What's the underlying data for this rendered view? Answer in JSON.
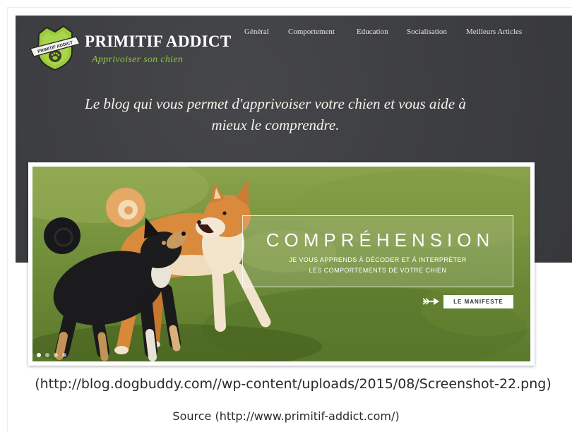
{
  "site": {
    "logo_ribbon": "PRIMITIF ADDICT",
    "title": "PRIMITIF ADDICT",
    "subtitle": "Apprivoiser son chien"
  },
  "nav": [
    {
      "label": "Général"
    },
    {
      "label": "Comportement"
    },
    {
      "label": "Education"
    },
    {
      "label": "Socialisation"
    },
    {
      "label": "Meilleurs Articles"
    }
  ],
  "tagline": {
    "line1": "Le blog qui vous permet d'apprivoiser votre chien et vous aide à",
    "line2": "mieux le comprendre."
  },
  "banner": {
    "heading": "COMPRÉHENSION",
    "line1": "JE VOUS APPRENDS À DÉCODER ET À INTERPRÉTER",
    "line2": "LES COMPORTEMENTS DE VOTRE CHIEN",
    "cta_label": "LE MANIFESTE",
    "slider": {
      "slide_count": 4,
      "active_index": 0
    }
  },
  "caption": {
    "image_url_text": "(http://blog.dogbuddy.com//wp-content/uploads/2015/08/Screenshot-22.png)",
    "source_text": "Source (http://www.primitif-addict.com/)"
  },
  "colors": {
    "header_bg": "#3e3f42",
    "accent_green": "#8cc63e",
    "caption_text": "#2a2a2a"
  },
  "icons": {
    "logo": "logo-badge-icon",
    "logo_mark": "paw-icon",
    "cta_arrow": "arrow-right-icon"
  }
}
